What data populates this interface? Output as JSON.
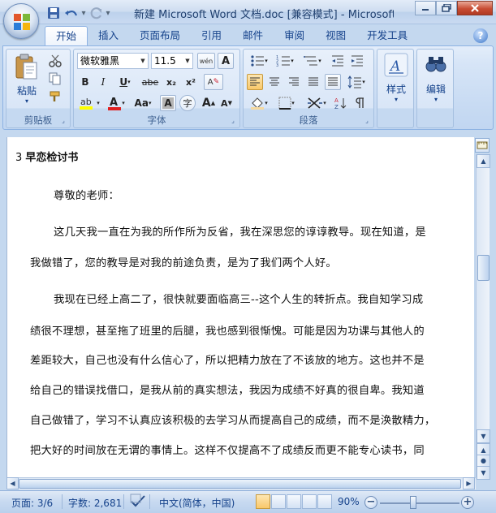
{
  "window": {
    "title": "新建 Microsoft Word 文档.doc [兼容模式] - Microsoft Word"
  },
  "quick_access": {
    "items": [
      "save-icon",
      "undo-icon",
      "redo-icon",
      "customize-dropdown-icon"
    ]
  },
  "tabs": [
    {
      "label": "开始",
      "active": true
    },
    {
      "label": "插入"
    },
    {
      "label": "页面布局"
    },
    {
      "label": "引用"
    },
    {
      "label": "邮件"
    },
    {
      "label": "审阅"
    },
    {
      "label": "视图"
    },
    {
      "label": "开发工具"
    }
  ],
  "ribbon": {
    "clipboard": {
      "label": "剪贴板",
      "paste": "粘贴"
    },
    "font": {
      "label": "字体",
      "font_name": "微软雅黑",
      "font_size": "11.5",
      "wen_label": "wén",
      "bold": "B",
      "italic": "I",
      "underline": "U",
      "strike": "abe",
      "sub": "x₂",
      "sup": "x²",
      "change_case": "Aa",
      "char_shade": "A",
      "grow": "A",
      "shrink": "A",
      "clear_format": "A",
      "enclose": "字"
    },
    "paragraph": {
      "label": "段落"
    },
    "styles": {
      "label": "样式"
    },
    "editing": {
      "label": "编辑"
    }
  },
  "document": {
    "heading_number": "3",
    "heading_text": "早恋检讨书",
    "lines": [
      "尊敬的老师：",
      "这几天我一直在为我的所作所为反省，我在深思您的谆谆教导。现在知道，是",
      "我做错了，您的教导是对我的前途负责，是为了我们两个人好。",
      "我现在已经上高二了，很快就要面临高三--这个人生的转折点。我自知学习成",
      "绩很不理想，甚至拖了班里的后腿，我也感到很惭愧。可能是因为功课与其他人的",
      "差距较大，自己也没有什么信心了，所以把精力放在了不该放的地方。这也并不是",
      "给自己的错误找借口，是我从前的真实想法，我因为成绩不好真的很自卑。我知道",
      "自己做错了，学习不认真应该积极的去学习从而提高自己的成绩，而不是涣散精力，",
      "把大好的时间放在无谓的事情上。这样不仅提高不了成绩反而更不能专心读书，同"
    ]
  },
  "status": {
    "page": "页面: 3/6",
    "words": "字数: 2,681",
    "language": "中文(简体，中国)",
    "zoom": "90%"
  },
  "colors": {
    "accent": "#15428b",
    "ribbon_bg": "#c8dbf3",
    "window_frame": "#c4d8ef"
  }
}
